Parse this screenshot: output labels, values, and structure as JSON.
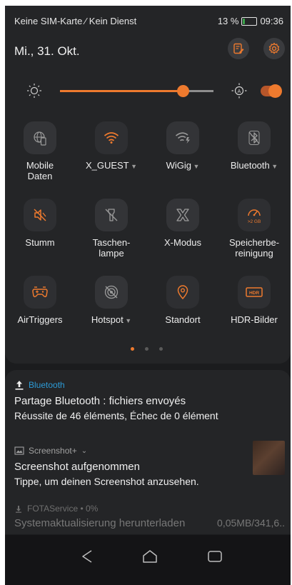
{
  "status_bar": {
    "carrier": "Keine SIM-Karte ∕ Kein Dienst",
    "battery": "13 %",
    "time": "09:36"
  },
  "header": {
    "date": "Mi., 31. Okt."
  },
  "brightness": {
    "level": 0.8,
    "auto_enabled": true
  },
  "tiles": [
    {
      "label": "Mobile Daten",
      "icon": "globe-phone-icon",
      "active": false,
      "caret": false
    },
    {
      "label": "X_GUEST",
      "icon": "wifi-icon",
      "active": true,
      "caret": true
    },
    {
      "label": "WiGig",
      "icon": "wigig-icon",
      "active": false,
      "caret": true
    },
    {
      "label": "Bluetooth",
      "icon": "bluetooth-off-icon",
      "active": false,
      "caret": true
    },
    {
      "label": "Stumm",
      "icon": "mute-icon",
      "active": true,
      "caret": false
    },
    {
      "label": "Taschen-lampe",
      "icon": "flashlight-icon",
      "active": false,
      "caret": false
    },
    {
      "label": "X-Modus",
      "icon": "x-mode-icon",
      "active": false,
      "caret": false
    },
    {
      "label": "Speicherbe-reinigung",
      "icon": "memory-clean-icon",
      "active": true,
      "caret": false,
      "badge": ">2 GB"
    },
    {
      "label": "AirTriggers",
      "icon": "gamepad-icon",
      "active": true,
      "caret": false
    },
    {
      "label": "Hotspot",
      "icon": "hotspot-icon",
      "active": false,
      "caret": true
    },
    {
      "label": "Standort",
      "icon": "location-icon",
      "active": true,
      "caret": false
    },
    {
      "label": "HDR-Bilder",
      "icon": "hdr-icon",
      "active": true,
      "caret": false
    }
  ],
  "page_indicator": {
    "pages": 3,
    "current": 1
  },
  "notifications": [
    {
      "app": "Bluetooth",
      "title": "Partage Bluetooth : fichiers envoyés",
      "text": "Réussite de 46 éléments, Échec de 0 élément"
    },
    {
      "app": "Screenshot+",
      "title": "Screenshot aufgenommen",
      "text": "Tippe, um deinen Screenshot anzusehen."
    },
    {
      "app": "FOTAService • 0%",
      "title": "Systemaktualisierung herunterladen",
      "size": "0,05MB/341,6.."
    }
  ],
  "colors": {
    "accent": "#ee7a2e",
    "panel": "#242527",
    "text": "#f0f0f0"
  }
}
